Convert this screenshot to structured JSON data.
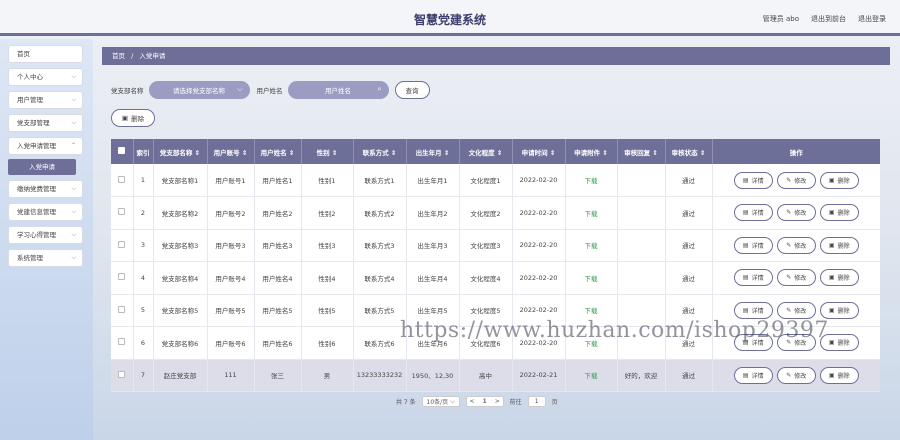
{
  "header": {
    "title": "智慧党建系统",
    "admin": "管理员 abo",
    "back": "退出到前台",
    "logout": "退出登录"
  },
  "sidebar": {
    "items": [
      {
        "label": "首页",
        "chevron": false
      },
      {
        "label": "个人中心",
        "chevron": true
      },
      {
        "label": "用户管理",
        "chevron": true
      },
      {
        "label": "党支部管理",
        "chevron": true
      },
      {
        "label": "入党申请管理",
        "chevron": true
      },
      {
        "label": "缴纳党费管理",
        "chevron": true
      },
      {
        "label": "党建信息管理",
        "chevron": true
      },
      {
        "label": "学习心得管理",
        "chevron": true
      },
      {
        "label": "系统管理",
        "chevron": true
      }
    ],
    "active_sub": "入党申请"
  },
  "breadcrumb": {
    "home": "首页",
    "sep": "/",
    "current": "入党申请"
  },
  "filter": {
    "branch_label": "党支部名称",
    "branch_placeholder": "请选择党支部名称",
    "user_label": "用户姓名",
    "user_placeholder": "用户姓名",
    "query_button": "查询"
  },
  "toolbar": {
    "delete_label": "删除"
  },
  "table": {
    "headers": [
      "索引",
      "党支部名称",
      "用户账号",
      "用户姓名",
      "性别",
      "联系方式",
      "出生年月",
      "文化程度",
      "申请时间",
      "申请附件",
      "审核回复",
      "审核状态",
      "操作"
    ],
    "rows": [
      {
        "idx": "1",
        "branch": "党支部名称1",
        "account": "用户账号1",
        "name": "用户姓名1",
        "gender": "性别1",
        "contact": "联系方式1",
        "birth": "出生年月1",
        "edu": "文化程度1",
        "time": "2022-02-20",
        "file": "下载",
        "reply": "",
        "status": "通过"
      },
      {
        "idx": "2",
        "branch": "党支部名称2",
        "account": "用户账号2",
        "name": "用户姓名2",
        "gender": "性别2",
        "contact": "联系方式2",
        "birth": "出生年月2",
        "edu": "文化程度2",
        "time": "2022-02-20",
        "file": "下载",
        "reply": "",
        "status": "通过"
      },
      {
        "idx": "3",
        "branch": "党支部名称3",
        "account": "用户账号3",
        "name": "用户姓名3",
        "gender": "性别3",
        "contact": "联系方式3",
        "birth": "出生年月3",
        "edu": "文化程度3",
        "time": "2022-02-20",
        "file": "下载",
        "reply": "",
        "status": "通过"
      },
      {
        "idx": "4",
        "branch": "党支部名称4",
        "account": "用户账号4",
        "name": "用户姓名4",
        "gender": "性别4",
        "contact": "联系方式4",
        "birth": "出生年月4",
        "edu": "文化程度4",
        "time": "2022-02-20",
        "file": "下载",
        "reply": "",
        "status": "通过"
      },
      {
        "idx": "5",
        "branch": "党支部名称5",
        "account": "用户账号5",
        "name": "用户姓名5",
        "gender": "性别5",
        "contact": "联系方式5",
        "birth": "出生年月5",
        "edu": "文化程度5",
        "time": "2022-02-20",
        "file": "下载",
        "reply": "",
        "status": "通过"
      },
      {
        "idx": "6",
        "branch": "党支部名称6",
        "account": "用户账号6",
        "name": "用户姓名6",
        "gender": "性别6",
        "contact": "联系方式6",
        "birth": "出生年月6",
        "edu": "文化程度6",
        "time": "2022-02-20",
        "file": "下载",
        "reply": "",
        "status": "通过"
      },
      {
        "idx": "7",
        "branch": "赵庄党支部",
        "account": "111",
        "name": "张三",
        "gender": "男",
        "contact": "13233333232",
        "birth": "1950、12,30",
        "edu": "高中",
        "time": "2022-02-21",
        "file": "下载",
        "reply": "好的，欢迎",
        "status": "通过"
      }
    ],
    "ops": {
      "detail": "详情",
      "edit": "修改",
      "delete": "删除"
    }
  },
  "pager": {
    "total": "共 7 条",
    "page_size": "10条/页",
    "prev": "<",
    "current": "1",
    "next": ">",
    "goto": "前往",
    "goto_value": "1",
    "page_unit": "页"
  },
  "watermark": "https://www.huzhan.com/ishop29397"
}
